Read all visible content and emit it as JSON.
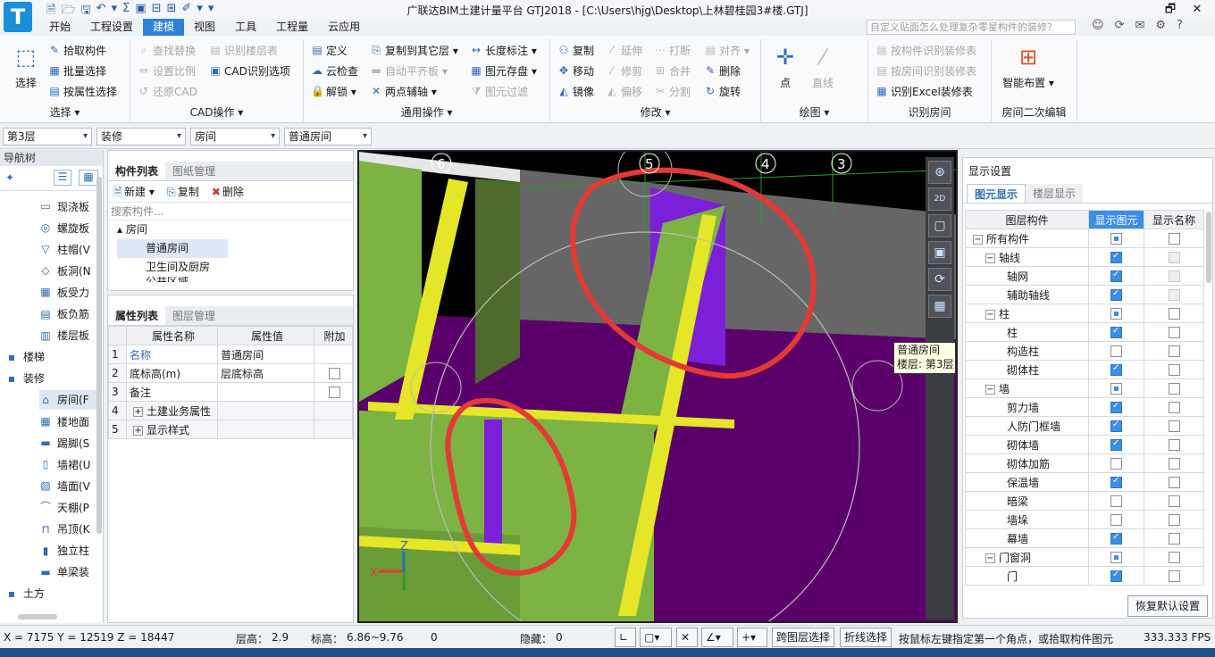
{
  "app": {
    "logo": "T",
    "title": "广联达BIM土建计量平台 GTJ2018 - [C:\\Users\\hjg\\Desktop\\上林碧桂园3#楼.GTJ]",
    "quick_access": [
      "🗎",
      "🗁",
      "🖫",
      "↶",
      "▾",
      "Σ",
      "▣",
      "⊟",
      "⊞",
      "✐",
      "▾",
      "▾"
    ],
    "window_controls": {
      "restore": "🗗",
      "close": "✕"
    }
  },
  "menu_tabs": [
    {
      "label": "开始"
    },
    {
      "label": "工程设置"
    },
    {
      "label": "建模",
      "active": true
    },
    {
      "label": "视图"
    },
    {
      "label": "工具"
    },
    {
      "label": "工程量"
    },
    {
      "label": "云应用"
    }
  ],
  "help_search": {
    "placeholder": "自定义贴面怎么处理复杂零星构件的装修？"
  },
  "ribbon": {
    "select_group": {
      "label": "选择 ▾",
      "big": "选择",
      "pick": "拾取构件",
      "batch": "批量选择",
      "by_attr": "按属性选择"
    },
    "cad_group": {
      "label": "CAD操作 ▾",
      "find_replace": "查找替换",
      "set_scale": "设置比例",
      "restore_cad": "还原CAD",
      "recognize_floor": "识别楼层表",
      "cad_options": "CAD识别选项"
    },
    "common_group": {
      "label": "通用操作 ▾",
      "define": "定义",
      "cloud_check": "云检查",
      "unlock": "解锁 ▾",
      "copy_floor": "复制到其它层 ▾",
      "auto_level": "自动平齐板 ▾",
      "two_point": "两点辅轴 ▾",
      "dim": "长度标注 ▾",
      "save_elem": "图元存盘 ▾",
      "filter_elem": "图元过滤"
    },
    "modify_group": {
      "label": "修改 ▾",
      "copy": "复制",
      "move": "移动",
      "mirror": "镜像",
      "extend": "延伸",
      "trim": "修剪",
      "offset": "偏移",
      "break": "打断",
      "merge": "合并",
      "split": "分割",
      "align": "对齐 ▾",
      "delete": "删除",
      "rotate": "旋转"
    },
    "draw_group": {
      "label": "绘图 ▾",
      "point": "点",
      "line": "直线"
    },
    "recog_group": {
      "label": "识别房间",
      "by_elem": "按构件识别装修表",
      "by_room": "按房间识别装修表",
      "excel": "识别Excel装修表"
    },
    "room_edit_group": {
      "label": "房间二次编辑",
      "smart": "智能布置 ▾"
    }
  },
  "filter_bar": {
    "floor": "第3层",
    "category": "装修",
    "type": "房间",
    "element": "普通房间"
  },
  "nav_tree": {
    "title": "导航树",
    "items": [
      {
        "label": "现浇板",
        "icon": "▭",
        "indent": 2
      },
      {
        "label": "螺旋板",
        "icon": "◎",
        "indent": 2
      },
      {
        "label": "柱帽(V",
        "icon": "▽",
        "indent": 2
      },
      {
        "label": "板洞(N",
        "icon": "◇",
        "indent": 2
      },
      {
        "label": "板受力",
        "icon": "▦",
        "indent": 2
      },
      {
        "label": "板负筋",
        "icon": "▤",
        "indent": 2
      },
      {
        "label": "楼层板",
        "icon": "▥",
        "indent": 2
      },
      {
        "label": "楼梯",
        "icon": "▪",
        "indent": 1,
        "folder": true
      },
      {
        "label": "装修",
        "icon": "▪",
        "indent": 1,
        "folder": true
      },
      {
        "label": "房间(F",
        "icon": "⌂",
        "indent": 2,
        "selected": true
      },
      {
        "label": "楼地面",
        "icon": "▦",
        "indent": 2
      },
      {
        "label": "踢脚(S",
        "icon": "▬",
        "indent": 2
      },
      {
        "label": "墙裙(U",
        "icon": "▯",
        "indent": 2
      },
      {
        "label": "墙面(V",
        "icon": "▧",
        "indent": 2
      },
      {
        "label": "天棚(P",
        "icon": "⌒",
        "indent": 2
      },
      {
        "label": "吊顶(K",
        "icon": "⊓",
        "indent": 2
      },
      {
        "label": "独立柱",
        "icon": "▮",
        "indent": 2
      },
      {
        "label": "单梁装",
        "icon": "▬",
        "indent": 2
      },
      {
        "label": "土方",
        "icon": "▪",
        "indent": 1,
        "folder": true
      }
    ]
  },
  "component_list": {
    "tabs": [
      "构件列表",
      "图纸管理"
    ],
    "toolbar": {
      "new": "新建 ▾",
      "copy": "复制",
      "delete": "删除"
    },
    "search_placeholder": "搜索构件...",
    "root": "房间",
    "items": [
      "普通房间",
      "卫生间及厨房",
      "公共区域"
    ]
  },
  "property_list": {
    "tabs": [
      "属性列表",
      "图层管理"
    ],
    "headers": [
      "属性名称",
      "属性值",
      "附加"
    ],
    "rows": [
      {
        "no": "1",
        "name": "名称",
        "value": "普通房间",
        "extra": ""
      },
      {
        "no": "2",
        "name": "底标高(m)",
        "value": "层底标高",
        "extra": "cb"
      },
      {
        "no": "3",
        "name": "备注",
        "value": "",
        "extra": "cb"
      },
      {
        "no": "4",
        "name": "土建业务属性",
        "value": "",
        "extra": "",
        "group": true
      },
      {
        "no": "5",
        "name": "显示样式",
        "value": "",
        "extra": "",
        "group": true
      }
    ]
  },
  "viewport": {
    "axis_labels": [
      "6",
      "5",
      "4",
      "3"
    ],
    "tooltip_line1": "普通房间",
    "tooltip_line2": "楼层: 第3层",
    "tools": [
      "⊛",
      "2D",
      "▢",
      "▣",
      "⟳",
      "▦"
    ]
  },
  "display_settings": {
    "title": "显示设置",
    "tabs": [
      "图元显示",
      "楼层显示"
    ],
    "headers": [
      "图层构件",
      "显示图元",
      "显示名称"
    ],
    "rows": [
      {
        "label": "所有构件",
        "level": 0,
        "expander": "−",
        "show": "part",
        "name": "off"
      },
      {
        "label": "轴线",
        "level": 1,
        "expander": "−",
        "show": "on",
        "name": "grey"
      },
      {
        "label": "轴网",
        "level": 2,
        "show": "on",
        "name": "grey"
      },
      {
        "label": "辅助轴线",
        "level": 2,
        "show": "on",
        "name": "grey"
      },
      {
        "label": "柱",
        "level": 1,
        "expander": "−",
        "show": "part",
        "name": "off"
      },
      {
        "label": "柱",
        "level": 2,
        "show": "on",
        "name": "off"
      },
      {
        "label": "构造柱",
        "level": 2,
        "show": "off",
        "name": "off"
      },
      {
        "label": "砌体柱",
        "level": 2,
        "show": "on",
        "name": "off"
      },
      {
        "label": "墙",
        "level": 1,
        "expander": "−",
        "show": "part",
        "name": "off"
      },
      {
        "label": "剪力墙",
        "level": 2,
        "show": "on",
        "name": "off"
      },
      {
        "label": "人防门框墙",
        "level": 2,
        "show": "on",
        "name": "off"
      },
      {
        "label": "砌体墙",
        "level": 2,
        "show": "on",
        "name": "off"
      },
      {
        "label": "砌体加筋",
        "level": 2,
        "show": "off",
        "name": "off"
      },
      {
        "label": "保温墙",
        "level": 2,
        "show": "on",
        "name": "off"
      },
      {
        "label": "暗梁",
        "level": 2,
        "show": "off",
        "name": "off"
      },
      {
        "label": "墙垛",
        "level": 2,
        "show": "off",
        "name": "off"
      },
      {
        "label": "幕墙",
        "level": 2,
        "show": "on",
        "name": "off"
      },
      {
        "label": "门窗洞",
        "level": 1,
        "expander": "−",
        "show": "part",
        "name": "off"
      },
      {
        "label": "门",
        "level": 2,
        "show": "on",
        "name": "off"
      }
    ],
    "restore_button": "恢复默认设置"
  },
  "status_bar": {
    "coords": "X = 7175 Y = 12519 Z = 18447",
    "floor_height_label": "层高：",
    "floor_height": "2.9",
    "elevation_label": "标高：",
    "elevation": "6.86~9.76",
    "zero": "0",
    "hidden_label": "隐藏：",
    "hidden": "0",
    "cross_layer": "跨图层选择",
    "polyline": "折线选择",
    "hint": "按鼠标左键指定第一个角点，或拾取构件图元",
    "fps": "333.333 FPS"
  }
}
